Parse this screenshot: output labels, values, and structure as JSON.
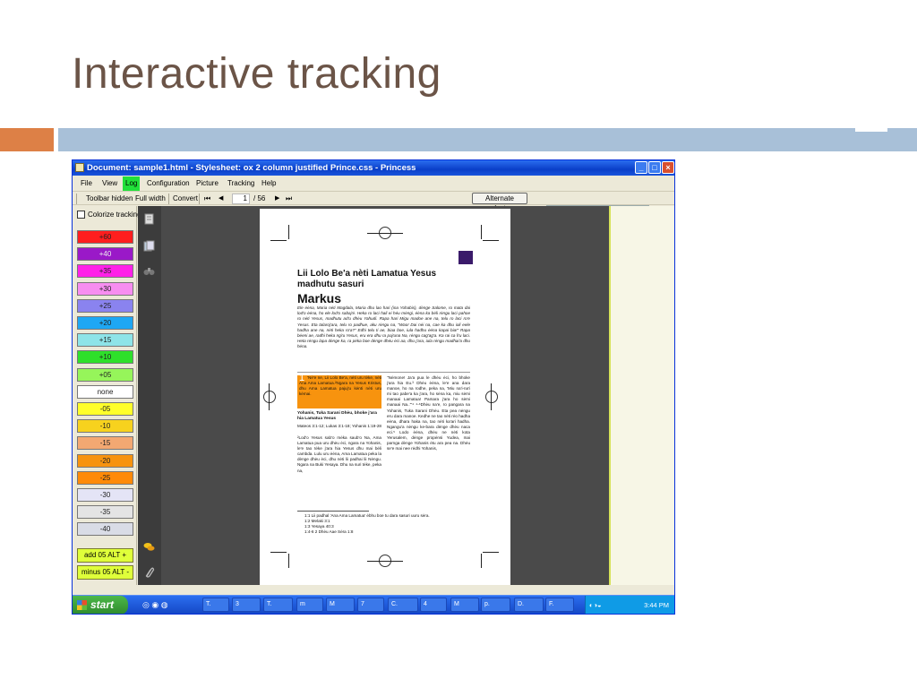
{
  "slide": {
    "title": "Interactive tracking"
  },
  "app": {
    "window_title": "Document: sample1.html - Stylesheet: ox 2 column justified Prince.css - Princess",
    "menu": [
      "File",
      "View",
      "Log",
      "Configuration",
      "Picture",
      "Tracking",
      "Help"
    ],
    "active_menu": "Log",
    "toolbar": {
      "toolbar_hidden": "Toolbar hidden",
      "full_width": "Full width",
      "convert": "Convert",
      "first": "⏮",
      "prev": "◀",
      "page": "1",
      "page_total": "/ 56",
      "next": "▶",
      "last": "⏭",
      "alternate_selector": "Alternate selector"
    },
    "left_panel": {
      "colorize_tracking": "Colorize tracking",
      "swatches": [
        {
          "label": "+60",
          "color": "#ff1e1e"
        },
        {
          "label": "+40",
          "color": "#9a19c8"
        },
        {
          "label": "+35",
          "color": "#ff21e8"
        },
        {
          "label": "+30",
          "color": "#f78df0"
        },
        {
          "label": "+25",
          "color": "#8a83ef"
        },
        {
          "label": "+20",
          "color": "#1ea7f4"
        },
        {
          "label": "+15",
          "color": "#8ee4e8"
        },
        {
          "label": "+10",
          "color": "#2ee02a"
        },
        {
          "label": "+05",
          "color": "#96f55a"
        },
        {
          "label": "none",
          "color": "#ffffff"
        },
        {
          "label": "-05",
          "color": "#ffff2a"
        },
        {
          "label": "-10",
          "color": "#f7d21e"
        },
        {
          "label": "-15",
          "color": "#f3a872"
        },
        {
          "label": "-20",
          "color": "#f7930e"
        },
        {
          "label": "-25",
          "color": "#ff8a08"
        },
        {
          "label": "-30",
          "color": "#e4e4f6"
        },
        {
          "label": "-35",
          "color": "#e4e4e4"
        },
        {
          "label": "-40",
          "color": "#d9dce6"
        }
      ],
      "add_button": "add 05    ALT +",
      "minus_button": "minus 05    ALT -"
    },
    "document": {
      "heading": "Lii Lolo Be'a nèti Lamatua Yesus madhutu sasuri",
      "subheading": "Markus",
      "intro": "Ele ėėna, Maria nėti Magdala, Maria dhu lao hari (ina Yohabis), dėnge Salome, ro mata dai lod'o ėėna, ho ele lod'o sabaj'ė. Heka ro laci hali ei hėu mėngi, ėėna ka bėli rėngu laci pahoe ro nėti Yesus, madhutu ad'u dhėu Yahudi. Rapa hari Migu madoe ane na, telu ro laci ro'e Yesus. Eta talaroj'ara, telu ro padhue, aku rėngu na, \"Wao! Dai nėi na, cae ka dhu ioli eele hadha ane na, nėti heka ro'a?\" Edhi telu ti ae, biaa boe, iula hadhu ėėna kapai bia!\" Rapa bėeni ae, radhi heka ngi'u Yesus, eru era dhu ra paj'una Na, rėngu cag'ag'a. Ka rai ca li'u laci. Heta rėngu lapa dėnge ka, ra pėka boe dėnge dhėu ėci aa, dhu j'ara, iula rėngu madhai'a dhu hėna.",
      "chapter_number": "1",
      "col1_hl": "'Nė'e ne, Lii Lolo Be'a, nėti uru tėke, nėti Ana Ama Lamatua.²Ngara na Yesus Kristus, dhu Ama Lamatua pajuj'u kėnti nėti uru kėmai.",
      "col1_section": "Yohanis, Tuka Sarani Dhėu, bhoke j'ara hia Lamatua Yesus",
      "col1_refs": "Mateos 3:1-12; Lukas 3:1-18; Yohanis 1:19-28",
      "col1_body": "²Lod'o Yesus sab'o mėka saub'o Na, Ama Lamatua pua uru dhėu ėci, ngara na Yohanis, le'e tao tėke j'ara hia Yesus dhu mai bėli cambda. Lulu uru ėėna, Ama Lamatua peka la dėnge dhėu ėci, dhu nėti lii padhai lii Nėngu. Ngara na Buki Yesaya. Dhu na suri tėke, peka na,",
      "col2_body": "\"Nėmone! Ja'a pua le dhėu ėci, ho bhoke j'ara hia Eu.³ Dhėu ėėna, le'e ana dara manoe, ho na rodhe, peka na, 'Miu na'i-na'i mi tao pabe'a ka j'ara, ho sėna ka, miu sėmi manaai Lamatua! Pamara j'ara ho sėmi manaai Na..'\"⁴ ⁴-⁶Dhėu na'e, ro pangara na Yohanis, Tuka Sarani Dhėu. Eta pea nėngu eru dara manoe. Kedhe ne tao nėti rėo hadha eėna, dhara haka na, tao nėti ka'ari hadha. Ngangu'a nėngu ke-bara dėnge dhėu naca eci.⁵ Lodo ėėna, dhėu ne nėti kota Yerusalem, dėnge propėnsi Yudea, mai parnga dėnge Yohanis ėtu ara pea na. Dhėu se'e mai nee rėdhi Yohanis,",
      "footnotes": [
        "1:1 Lii padhal 'Ana Ama Lamatua' ėbhu boe tu dara sasuri uuru sėra.",
        "1:2 Melaki 3:1",
        "1:3 Yesaya 40:3",
        "1:4-6 2 Dhėu Aae Sėra 1:8"
      ]
    },
    "taskbar": {
      "start": "start",
      "tasks": [
        "T.",
        "3",
        "T.",
        "m",
        "M",
        "7",
        "C.",
        "4",
        "M",
        "p.",
        "D.",
        "F."
      ],
      "clock": "3:44 PM"
    }
  }
}
